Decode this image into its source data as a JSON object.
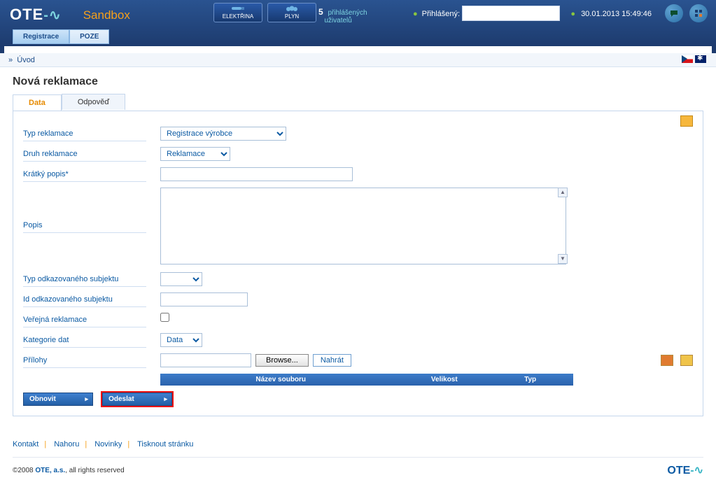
{
  "header": {
    "logo_main": "OTE",
    "sandbox": "Sandbox",
    "mod_elektrina": "ELEKTŘINA",
    "mod_plyn": "PLYN",
    "users_count": "5",
    "users_label1": "přihlášených",
    "users_label2": "uživatelů",
    "logged_label": "Přihlášený:",
    "datetime": "30.01.2013 15:49:46",
    "nav_registrace": "Registrace",
    "nav_poze": "POZE"
  },
  "breadcrumb": {
    "arrow": "»",
    "home": "Úvod"
  },
  "page": {
    "title": "Nová reklamace",
    "tab_data": "Data",
    "tab_odpoved": "Odpověď"
  },
  "form": {
    "typ_reklamace_label": "Typ reklamace",
    "typ_reklamace_value": "Registrace výrobce",
    "druh_reklamace_label": "Druh reklamace",
    "druh_reklamace_value": "Reklamace",
    "kratky_popis_label": "Krátký popis*",
    "popis_label": "Popis",
    "typ_subjektu_label": "Typ odkazovaného subjektu",
    "typ_subjektu_value": "",
    "id_subjektu_label": "Id odkazovaného subjektu",
    "verejna_label": "Veřejná reklamace",
    "kategorie_label": "Kategorie dat",
    "kategorie_value": "Data",
    "prilohy_label": "Přílohy",
    "browse_btn": "Browse...",
    "upload_btn": "Nahrát",
    "th_nazev": "Název souboru",
    "th_velikost": "Velikost",
    "th_typ": "Typ",
    "btn_obnovit": "Obnovit",
    "btn_odeslat": "Odeslat"
  },
  "footer": {
    "kontakt": "Kontakt",
    "nahoru": "Nahoru",
    "novinky": "Novinky",
    "tisknout": "Tisknout stránku",
    "copy_year": "©2008 ",
    "copy_company": "OTE, a.s.",
    "copy_rights": ", all rights reserved",
    "foot_logo": "OTE"
  }
}
